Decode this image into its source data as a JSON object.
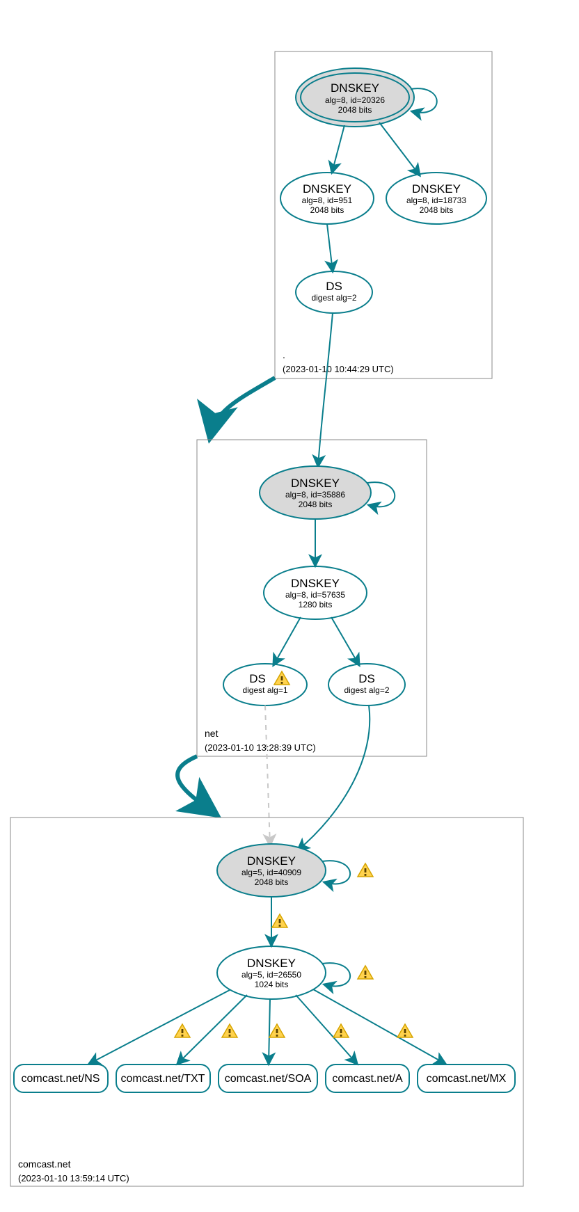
{
  "chart_data": {
    "type": "dnssec-graph",
    "zones": [
      {
        "name": ".",
        "timestamp": "(2023-01-10 10:44:29 UTC)",
        "nodes": [
          {
            "id": "root-ksk",
            "type": "DNSKEY",
            "alg": "alg=8, id=20326",
            "bits": "2048 bits",
            "ksk": true,
            "double": true
          },
          {
            "id": "root-zsk1",
            "type": "DNSKEY",
            "alg": "alg=8, id=951",
            "bits": "2048 bits"
          },
          {
            "id": "root-zsk2",
            "type": "DNSKEY",
            "alg": "alg=8, id=18733",
            "bits": "2048 bits"
          },
          {
            "id": "root-ds",
            "type": "DS",
            "alg": "digest alg=2"
          }
        ],
        "edges": [
          [
            "root-ksk",
            "root-ksk",
            "self"
          ],
          [
            "root-ksk",
            "root-zsk1"
          ],
          [
            "root-ksk",
            "root-zsk2"
          ],
          [
            "root-zsk1",
            "root-ds"
          ]
        ]
      },
      {
        "name": "net",
        "timestamp": "(2023-01-10 13:28:39 UTC)",
        "nodes": [
          {
            "id": "net-ksk",
            "type": "DNSKEY",
            "alg": "alg=8, id=35886",
            "bits": "2048 bits",
            "ksk": true
          },
          {
            "id": "net-zsk",
            "type": "DNSKEY",
            "alg": "alg=8, id=57635",
            "bits": "1280 bits"
          },
          {
            "id": "net-ds1",
            "type": "DS",
            "alg": "digest alg=1",
            "warn": true
          },
          {
            "id": "net-ds2",
            "type": "DS",
            "alg": "digest alg=2"
          }
        ],
        "edges": [
          [
            "root-ds",
            "net-ksk",
            "secure"
          ],
          [
            "net-ksk",
            "net-ksk",
            "self"
          ],
          [
            "net-ksk",
            "net-zsk"
          ],
          [
            "net-zsk",
            "net-ds1"
          ],
          [
            "net-zsk",
            "net-ds2"
          ]
        ]
      },
      {
        "name": "comcast.net",
        "timestamp": "(2023-01-10 13:59:14 UTC)",
        "nodes": [
          {
            "id": "cc-ksk",
            "type": "DNSKEY",
            "alg": "alg=5, id=40909",
            "bits": "2048 bits",
            "ksk": true,
            "warn": true
          },
          {
            "id": "cc-zsk",
            "type": "DNSKEY",
            "alg": "alg=5, id=26550",
            "bits": "1024 bits",
            "warn": true
          },
          {
            "id": "cc-ns",
            "type": "RR",
            "label": "comcast.net/NS"
          },
          {
            "id": "cc-txt",
            "type": "RR",
            "label": "comcast.net/TXT"
          },
          {
            "id": "cc-soa",
            "type": "RR",
            "label": "comcast.net/SOA"
          },
          {
            "id": "cc-a",
            "type": "RR",
            "label": "comcast.net/A"
          },
          {
            "id": "cc-mx",
            "type": "RR",
            "label": "comcast.net/MX"
          }
        ],
        "edges": [
          [
            "net-ds1",
            "cc-ksk",
            "dashed"
          ],
          [
            "net-ds2",
            "cc-ksk",
            "secure"
          ],
          [
            "cc-ksk",
            "cc-ksk",
            "self",
            "warn"
          ],
          [
            "cc-ksk",
            "cc-zsk",
            "warn"
          ],
          [
            "cc-zsk",
            "cc-zsk",
            "self",
            "warn"
          ],
          [
            "cc-zsk",
            "cc-ns",
            "warn"
          ],
          [
            "cc-zsk",
            "cc-txt",
            "warn"
          ],
          [
            "cc-zsk",
            "cc-soa",
            "warn"
          ],
          [
            "cc-zsk",
            "cc-a",
            "warn"
          ],
          [
            "cc-zsk",
            "cc-mx",
            "warn"
          ]
        ]
      }
    ]
  },
  "zones": {
    "root": {
      "label": ".",
      "ts": "(2023-01-10 10:44:29 UTC)"
    },
    "net": {
      "label": "net",
      "ts": "(2023-01-10 13:28:39 UTC)"
    },
    "comcast": {
      "label": "comcast.net",
      "ts": "(2023-01-10 13:59:14 UTC)"
    }
  },
  "nodes": {
    "root_ksk": {
      "title": "DNSKEY",
      "l2": "alg=8, id=20326",
      "l3": "2048 bits"
    },
    "root_zsk1": {
      "title": "DNSKEY",
      "l2": "alg=8, id=951",
      "l3": "2048 bits"
    },
    "root_zsk2": {
      "title": "DNSKEY",
      "l2": "alg=8, id=18733",
      "l3": "2048 bits"
    },
    "root_ds": {
      "title": "DS",
      "l2": "digest alg=2"
    },
    "net_ksk": {
      "title": "DNSKEY",
      "l2": "alg=8, id=35886",
      "l3": "2048 bits"
    },
    "net_zsk": {
      "title": "DNSKEY",
      "l2": "alg=8, id=57635",
      "l3": "1280 bits"
    },
    "net_ds1": {
      "title": "DS",
      "l2": "digest alg=1"
    },
    "net_ds2": {
      "title": "DS",
      "l2": "digest alg=2"
    },
    "cc_ksk": {
      "title": "DNSKEY",
      "l2": "alg=5, id=40909",
      "l3": "2048 bits"
    },
    "cc_zsk": {
      "title": "DNSKEY",
      "l2": "alg=5, id=26550",
      "l3": "1024 bits"
    },
    "cc_ns": "comcast.net/NS",
    "cc_txt": "comcast.net/TXT",
    "cc_soa": "comcast.net/SOA",
    "cc_a": "comcast.net/A",
    "cc_mx": "comcast.net/MX"
  }
}
